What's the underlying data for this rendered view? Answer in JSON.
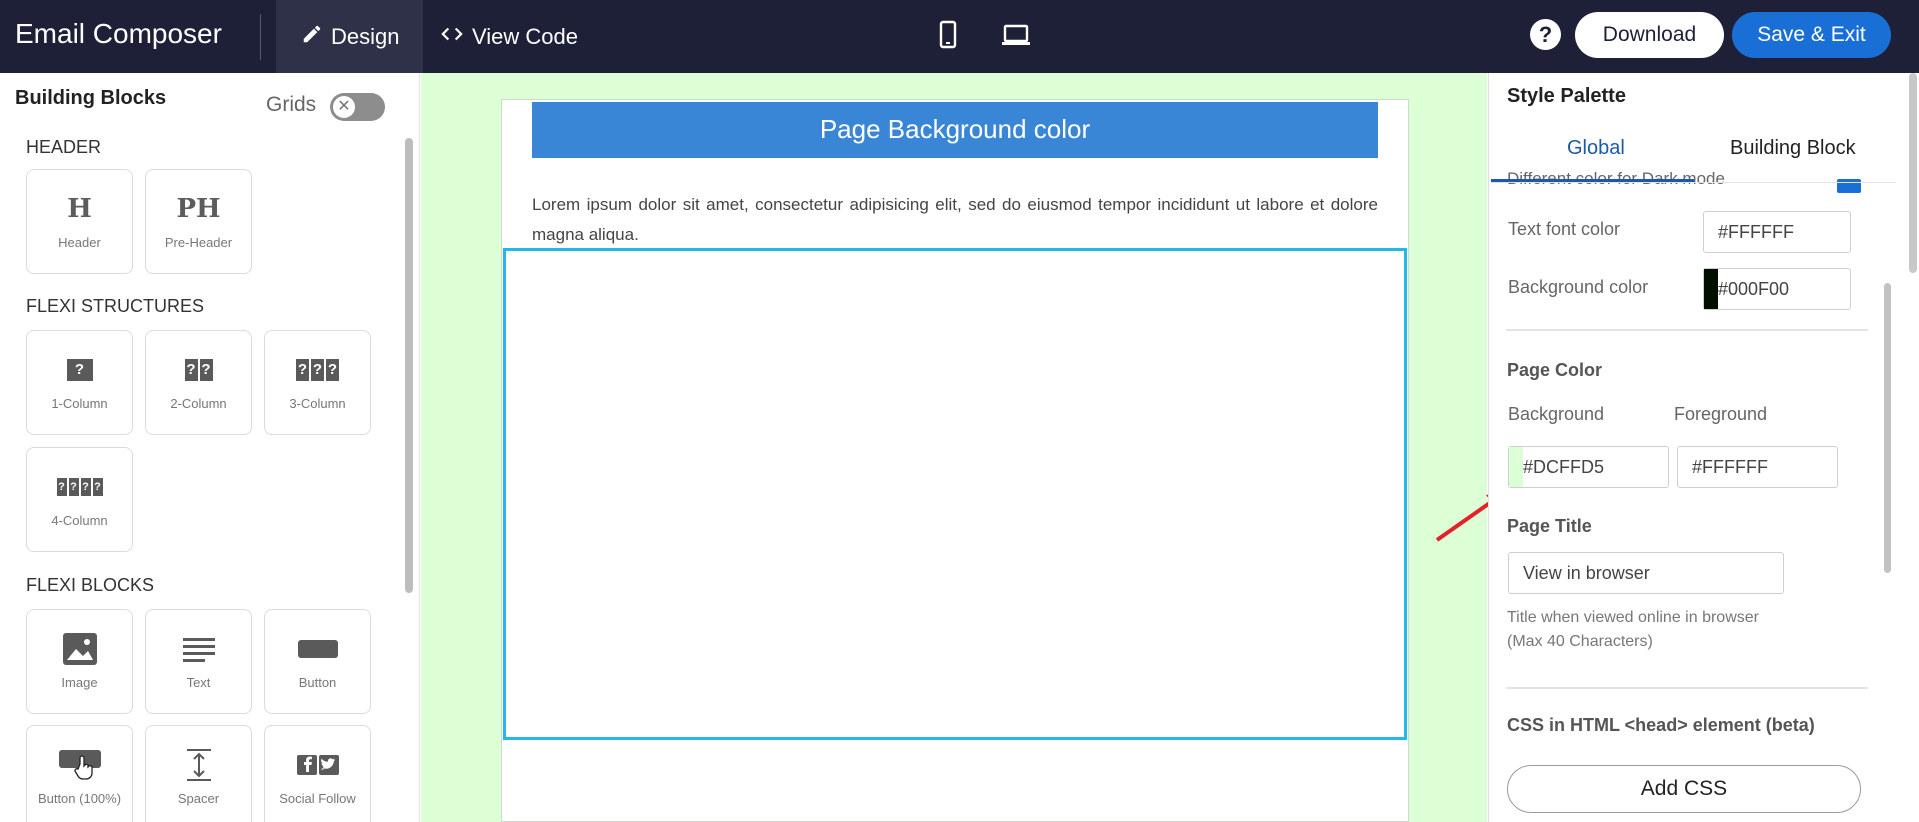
{
  "topbar": {
    "app_title": "Email Composer",
    "tabs": [
      {
        "label": "Design",
        "icon": "pencil-icon",
        "active": true
      },
      {
        "label": "View Code",
        "icon": "code-icon",
        "active": false
      }
    ],
    "devices": [
      {
        "icon": "mobile-icon"
      },
      {
        "icon": "desktop-icon"
      }
    ],
    "help_label": "?",
    "download_label": "Download",
    "save_label": "Save & Exit"
  },
  "sidebar": {
    "title": "Building Blocks",
    "grids_label": "Grids",
    "grids_on": false,
    "sections": [
      {
        "title": "HEADER",
        "blocks": [
          {
            "label": "Header",
            "glyph": "H"
          },
          {
            "label": "Pre-Header",
            "glyph": "PH"
          }
        ]
      },
      {
        "title": "FLEXI STRUCTURES",
        "blocks": [
          {
            "label": "1-Column"
          },
          {
            "label": "2-Column"
          },
          {
            "label": "3-Column"
          },
          {
            "label": "4-Column"
          }
        ]
      },
      {
        "title": "FLEXI BLOCKS",
        "blocks": [
          {
            "label": "Image"
          },
          {
            "label": "Text"
          },
          {
            "label": "Button"
          },
          {
            "label": "Button (100%)"
          },
          {
            "label": "Spacer"
          },
          {
            "label": "Social Follow"
          }
        ]
      }
    ]
  },
  "canvas": {
    "background": "#DCFFD5",
    "banner_text": "Page Background color",
    "lorem": "Lorem ipsum dolor sit amet, consectetur adipisicing elit, sed do eiusmod tempor incididunt ut labore et dolore magna aliqua."
  },
  "palette": {
    "title": "Style Palette",
    "tabs": [
      {
        "label": "Global",
        "active": true
      },
      {
        "label": "Building Block",
        "active": false
      }
    ],
    "cut_label": "Different color for Dark mode",
    "text_font_color_label": "Text font color",
    "text_font_color_value": "#FFFFFF",
    "background_color_label": "Background color",
    "background_color_value": "#000F00",
    "page_color_heading": "Page Color",
    "background_label": "Background",
    "foreground_label": "Foreground",
    "page_bg_value": "#DCFFD5",
    "page_fg_value": "#FFFFFF",
    "page_title_heading": "Page Title",
    "page_title_value": "View in browser",
    "helper_line1": "Title when viewed online in browser",
    "helper_line2": "(Max 40 Characters)",
    "css_heading": "CSS in HTML <head> element (beta)",
    "add_css_label": "Add CSS"
  },
  "colors": {
    "topbar_bg": "#1D2036",
    "accent_blue": "#1A6FD6",
    "banner_blue": "#3A86D6",
    "drop_outline": "#22B8EA",
    "swatch_dark": "#000F00",
    "swatch_light": "#DCFFD5",
    "arrow_red": "#E5202A"
  }
}
